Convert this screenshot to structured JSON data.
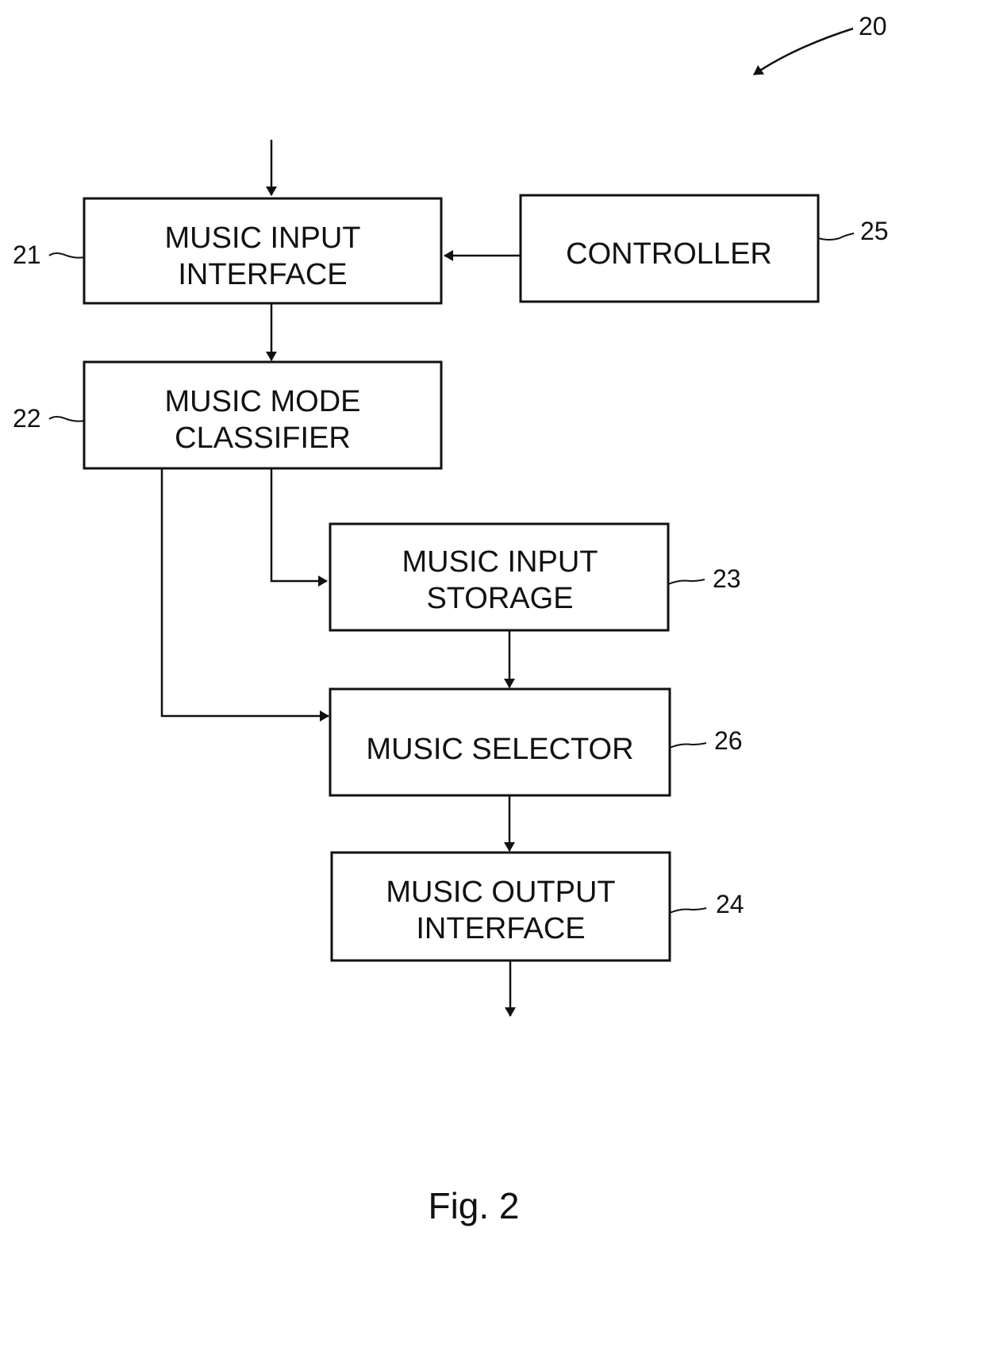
{
  "figure": {
    "reference_number": "20",
    "caption": "Fig. 2"
  },
  "blocks": [
    {
      "id": "music-input-interface",
      "ref": "21",
      "lines": [
        "MUSIC INPUT",
        "INTERFACE"
      ]
    },
    {
      "id": "music-mode-classifier",
      "ref": "22",
      "lines": [
        "MUSIC MODE",
        "CLASSIFIER"
      ]
    },
    {
      "id": "music-input-storage",
      "ref": "23",
      "lines": [
        "MUSIC INPUT",
        "STORAGE"
      ]
    },
    {
      "id": "music-output-interface",
      "ref": "24",
      "lines": [
        "MUSIC OUTPUT",
        "INTERFACE"
      ]
    },
    {
      "id": "controller",
      "ref": "25",
      "lines": [
        "CONTROLLER"
      ]
    },
    {
      "id": "music-selector",
      "ref": "26",
      "lines": [
        "MUSIC SELECTOR"
      ]
    }
  ],
  "connections": [
    {
      "from": "external-input",
      "to": "music-input-interface"
    },
    {
      "from": "controller",
      "to": "music-input-interface"
    },
    {
      "from": "music-input-interface",
      "to": "music-mode-classifier"
    },
    {
      "from": "music-mode-classifier",
      "to": "music-input-storage"
    },
    {
      "from": "music-mode-classifier",
      "to": "music-selector"
    },
    {
      "from": "music-input-storage",
      "to": "music-selector"
    },
    {
      "from": "music-selector",
      "to": "music-output-interface"
    },
    {
      "from": "music-output-interface",
      "to": "external-output"
    }
  ]
}
